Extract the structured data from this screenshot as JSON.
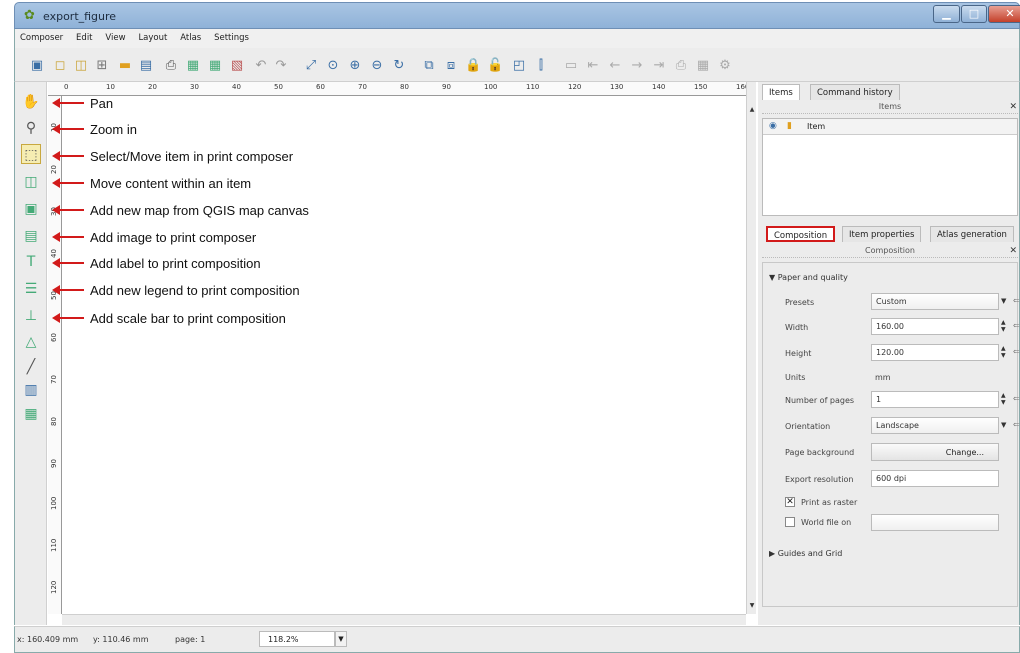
{
  "window": {
    "title": "export_figure"
  },
  "menu": [
    "Composer",
    "Edit",
    "View",
    "Layout",
    "Atlas",
    "Settings"
  ],
  "toolbar_icons": [
    "save-icon",
    "new-composer-icon",
    "duplicate-composer-icon",
    "composer-manager-icon",
    "open-template-icon",
    "save-template-icon",
    "print-icon",
    "export-image-icon",
    "export-svg-icon",
    "export-pdf-icon",
    "undo-icon",
    "redo-icon",
    "zoom-full-icon",
    "zoom-100-icon",
    "zoom-in-icon",
    "zoom-out-icon",
    "refresh-icon",
    "group-icon",
    "ungroup-icon",
    "lock-icon",
    "unlock-icon",
    "raise-icon",
    "align-icon",
    "atlas-preview-icon",
    "first-feature-icon",
    "prev-feature-icon",
    "next-feature-icon",
    "last-feature-icon",
    "print-atlas-icon",
    "export-atlas-icon",
    "atlas-settings-icon"
  ],
  "annotations": [
    "Pan",
    "Zoom in",
    "Select/Move item in print composer",
    "Move content within an item",
    "Add new map from QGIS map canvas",
    "Add image to print composer",
    "Add label to print composition",
    "Add new legend to print composition",
    "Add scale bar to print composition"
  ],
  "ruler_top": [
    "0",
    "10",
    "20",
    "30",
    "40",
    "50",
    "60",
    "70",
    "80",
    "90",
    "100",
    "110",
    "120",
    "130",
    "140",
    "150",
    "160"
  ],
  "ruler_left": [
    "10",
    "20",
    "30",
    "40",
    "50",
    "60",
    "70",
    "80",
    "90",
    "100",
    "110",
    "120"
  ],
  "top_tabs": {
    "items": "Items",
    "history": "Command history"
  },
  "items_panel": {
    "title": "Items",
    "column": "Item"
  },
  "prop_tabs": {
    "composition": "Composition",
    "item_props": "Item properties",
    "atlas": "Atlas generation"
  },
  "composition": {
    "title": "Composition",
    "section": "Paper and quality",
    "presets_label": "Presets",
    "presets_value": "Custom",
    "width_label": "Width",
    "width_value": "160.00",
    "height_label": "Height",
    "height_value": "120.00",
    "units_label": "Units",
    "units_value": "mm",
    "pages_label": "Number of pages",
    "pages_value": "1",
    "orient_label": "Orientation",
    "orient_value": "Landscape",
    "bg_label": "Page background",
    "bg_button": "Change...",
    "res_label": "Export resolution",
    "res_value": "600 dpi",
    "raster_label": "Print as raster",
    "world_label": "World file on",
    "guides": "Guides and Grid"
  },
  "status": {
    "x": "x: 160.409 mm",
    "y": "y: 110.46 mm",
    "page": "page: 1",
    "zoom": "118.2%"
  }
}
